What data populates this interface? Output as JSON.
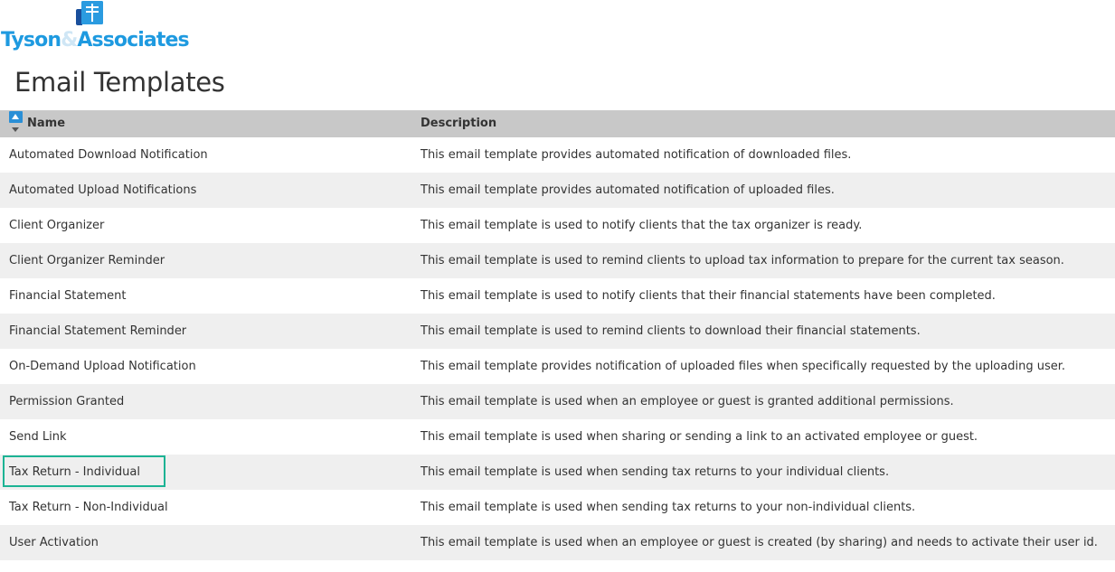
{
  "logo": {
    "name_part1": "Tyson",
    "ampersand": "&",
    "name_part2": "Associates",
    "icon": "document-logo-icon",
    "brand_color": "#1e9ae0"
  },
  "page": {
    "title": "Email Templates"
  },
  "table": {
    "header_bg": "#c8c8c8",
    "sort_icon": "sort-ascending-icon",
    "columns": {
      "name": "Name",
      "description": "Description"
    },
    "highlight_color": "#1cb394",
    "highlighted_row": "Tax Return - Individual",
    "rows": [
      {
        "name": "Automated Download Notification",
        "description": "This email template provides automated notification of downloaded files."
      },
      {
        "name": "Automated Upload Notifications",
        "description": "This email template provides automated notification of uploaded files."
      },
      {
        "name": "Client Organizer",
        "description": "This email template is used to notify clients that the tax organizer is ready."
      },
      {
        "name": "Client Organizer Reminder",
        "description": "This email template is used to remind clients to upload tax information to prepare for the current tax season."
      },
      {
        "name": "Financial Statement",
        "description": "This email template is used to notify clients that their financial statements have been completed."
      },
      {
        "name": "Financial Statement Reminder",
        "description": "This email template is used to remind clients to download their financial statements."
      },
      {
        "name": "On-Demand Upload Notification",
        "description": "This email template provides notification of uploaded files when specifically requested by the uploading user."
      },
      {
        "name": "Permission Granted",
        "description": "This email template is used when an employee or guest is granted additional permissions."
      },
      {
        "name": "Send Link",
        "description": "This email template is used when sharing or sending a link to an activated employee or guest."
      },
      {
        "name": "Tax Return - Individual",
        "description": "This email template is used when sending tax returns to your individual clients."
      },
      {
        "name": "Tax Return - Non-Individual",
        "description": "This email template is used when sending tax returns to your non-individual clients."
      },
      {
        "name": "User Activation",
        "description": "This email template is used when an employee or guest is created (by sharing) and needs to activate their user id."
      }
    ]
  }
}
